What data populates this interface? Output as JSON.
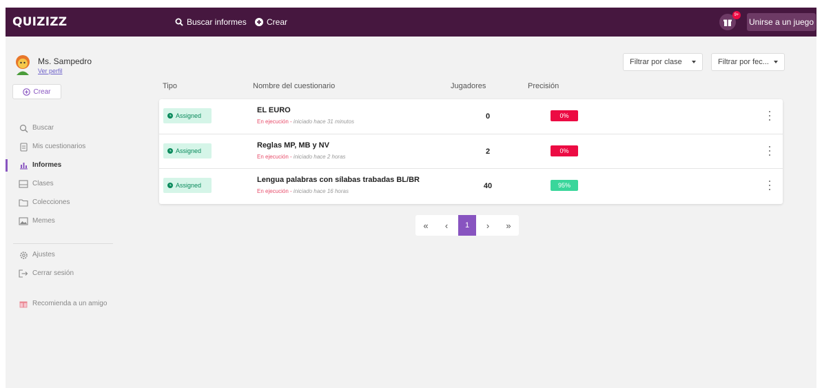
{
  "header": {
    "logo": "QUIZIZZ",
    "search_label": "Buscar informes",
    "create_label": "Crear",
    "gift_badge": "9+",
    "join_label": "Unirse a un juego"
  },
  "sidebar": {
    "user_name": "Ms. Sampedro",
    "profile_link": "Ver perfil",
    "create_label": "Crear",
    "items": [
      {
        "label": "Buscar",
        "icon": "search-icon"
      },
      {
        "label": "Mis cuestionarios",
        "icon": "document-icon"
      },
      {
        "label": "Informes",
        "icon": "chart-icon",
        "active": true
      },
      {
        "label": "Clases",
        "icon": "class-icon"
      },
      {
        "label": "Colecciones",
        "icon": "folder-icon"
      },
      {
        "label": "Memes",
        "icon": "image-icon"
      },
      {
        "label": "Ajustes",
        "icon": "gear-icon"
      },
      {
        "label": "Cerrar sesión",
        "icon": "logout-icon"
      },
      {
        "label": "Recomienda a un amigo",
        "icon": "gift-icon"
      }
    ]
  },
  "filters": {
    "class": "Filtrar por clase",
    "date": "Filtrar por fec..."
  },
  "table": {
    "columns": [
      "Tipo",
      "Nombre del cuestionario",
      "Jugadores",
      "Precisión"
    ],
    "rows": [
      {
        "type": "Assigned",
        "title": "EL EURO",
        "status": "En ejecución",
        "started": "iniciado hace 31 minutos",
        "players": "0",
        "accuracy": "0%",
        "accuracy_level": "low"
      },
      {
        "type": "Assigned",
        "title": "Reglas MP, MB y NV",
        "status": "En ejecución",
        "started": "iniciado hace 2 horas",
        "players": "2",
        "accuracy": "0%",
        "accuracy_level": "low"
      },
      {
        "type": "Assigned",
        "title": "Lengua palabras con sílabas trabadas BL/BR",
        "status": "En ejecución",
        "started": "iniciado hace 16 horas",
        "players": "40",
        "accuracy": "95%",
        "accuracy_level": "high"
      }
    ]
  },
  "pagination": {
    "first": "«",
    "prev": "‹",
    "current": "1",
    "next": "›",
    "last": "»"
  },
  "colors": {
    "header_bg": "#46173f",
    "accent": "#8854c0",
    "low": "#ec0b43",
    "high": "#3ad69b",
    "badge_bg": "#d5f5e8",
    "badge_text": "#0a8a5c"
  }
}
